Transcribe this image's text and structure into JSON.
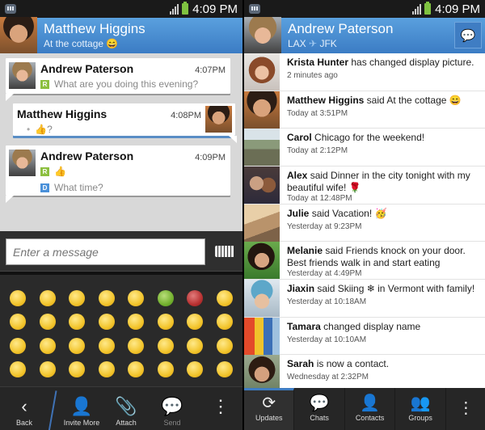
{
  "status_bar": {
    "time": "4:09 PM"
  },
  "left": {
    "header": {
      "name": "Matthew Higgins",
      "status": "At the cottage 😄"
    },
    "messages": [
      {
        "sender": "Andrew Paterson",
        "time": "4:07PM",
        "lines": [
          {
            "tag": "R",
            "text": "What are you doing this evening?"
          }
        ]
      },
      {
        "sender": "Matthew Higgins",
        "time": "4:08PM",
        "lines": [
          {
            "tag": "•",
            "text": "👍?"
          }
        ]
      },
      {
        "sender": "Andrew Paterson",
        "time": "4:09PM",
        "lines": [
          {
            "tag": "R",
            "text": "👍"
          },
          {
            "tag": "D",
            "text": "What time?"
          }
        ]
      }
    ],
    "input": {
      "placeholder": "Enter a message"
    },
    "emoji_icons": [
      "smile",
      "laugh",
      "tongue",
      "neutral",
      "thinking",
      "sick",
      "angry",
      "surprised",
      "happy",
      "hug",
      "wonder",
      "smirk",
      "rolleyes",
      "black-eye",
      "blush",
      "coffee",
      "grin",
      "wave",
      "love",
      "skeptical",
      "shy",
      "sad",
      "dizzy",
      "yawn",
      "big-grin",
      "party",
      "kiss",
      "meh",
      "confused",
      "cry",
      "confused-question",
      "dead"
    ],
    "toolbar": {
      "back": "Back",
      "invite": "Invite More",
      "attach": "Attach",
      "send": "Send"
    }
  },
  "right": {
    "header": {
      "name": "Andrew Paterson",
      "status_from": "LAX",
      "status_to": "JFK",
      "plane_icon": "✈"
    },
    "updates": [
      {
        "name": "Krista Hunter",
        "text": " has changed display picture.",
        "time": "2 minutes ago",
        "avatar": "krista"
      },
      {
        "name": "Matthew Higgins",
        "text": " said At the cottage 😄",
        "time": "Today at 3:51PM",
        "avatar": "matthew"
      },
      {
        "name": "Carol",
        "text": " Chicago for the weekend!",
        "time": "Today at 2:12PM",
        "avatar": "carol"
      },
      {
        "name": "Alex",
        "text": " said Dinner in the city tonight with my beautiful wife! 🌹",
        "time": "Today at 12:48PM",
        "avatar": "alex"
      },
      {
        "name": "Julie",
        "text": " said Vacation! 🥳",
        "time": "Yesterday at 9:23PM",
        "avatar": "julie"
      },
      {
        "name": "Melanie",
        "text": " said Friends knock on your door. Best friends walk in and start eating",
        "time": "Yesterday at 4:49PM",
        "avatar": "melanie"
      },
      {
        "name": "Jiaxin",
        "text": " said Skiing ❄ in Vermont with family!",
        "time": "Yesterday at 10:18AM",
        "avatar": "jiaxin"
      },
      {
        "name": "Tamara",
        "text": " changed display name",
        "time": "Yesterday at 10:10AM",
        "avatar": "tamara"
      },
      {
        "name": "Sarah",
        "text": " is now a contact.",
        "time": "Wednesday at 2:32PM",
        "avatar": "sarah"
      }
    ],
    "tabs": {
      "updates": "Updates",
      "chats": "Chats",
      "contacts": "Contacts",
      "groups": "Groups"
    }
  }
}
